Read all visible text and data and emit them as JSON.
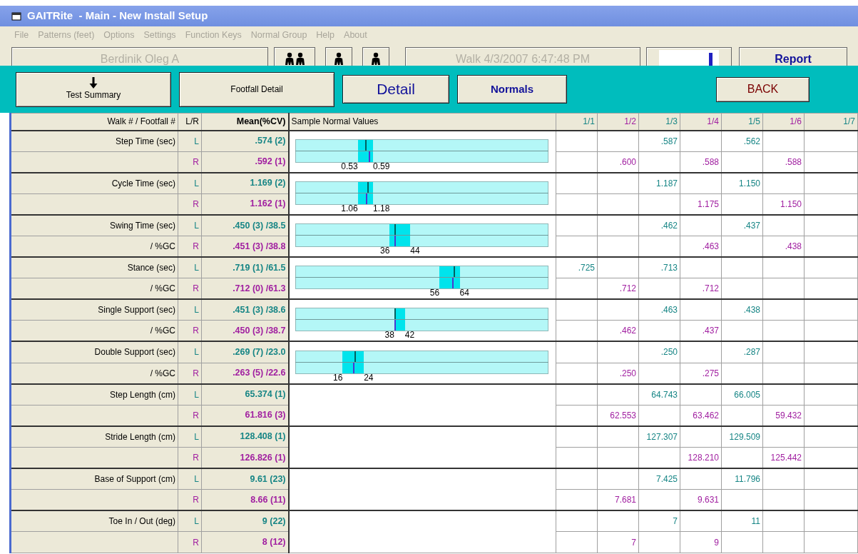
{
  "window": {
    "title": "GAITRite  - Main - New Install Setup"
  },
  "menu": [
    "File",
    "Patterns (feet)",
    "Options",
    "Settings",
    "Function Keys",
    "Normal Group",
    "Help",
    "About"
  ],
  "toolbar": {
    "patient": "Berdinik  Oleg A",
    "walk": "Walk  4/3/2007 6:47:48 PM",
    "report": "Report"
  },
  "nav_buttons": [
    {
      "label": "Test Summary",
      "kind": "arrow"
    },
    {
      "label": "Footfall Detail",
      "kind": "plain"
    },
    {
      "label": "Detail",
      "kind": "large"
    },
    {
      "label": "Normals",
      "kind": "bold"
    },
    {
      "label": "BACK",
      "kind": "back"
    }
  ],
  "table": {
    "columns": {
      "label": "Walk # / Footfall #",
      "side": "L/R",
      "mean": "Mean(%CV)",
      "normals": "Sample Normal Values"
    },
    "walk_columns": [
      {
        "label": "1/1",
        "color": "#168585"
      },
      {
        "label": "1/2",
        "color": "#a01ea0"
      },
      {
        "label": "1/3",
        "color": "#168585"
      },
      {
        "label": "1/4",
        "color": "#a01ea0"
      },
      {
        "label": "1/5",
        "color": "#168585"
      },
      {
        "label": "1/6",
        "color": "#a01ea0"
      },
      {
        "label": "1/7",
        "color": "#168585"
      }
    ],
    "groups": [
      {
        "rows": [
          {
            "label": "Step Time (sec)",
            "side": "L",
            "mean": ".574 (2)",
            "cells": [
              null,
              null,
              ".587",
              null,
              ".562",
              null,
              null
            ]
          },
          {
            "side": "R",
            "mean": ".592 (1)",
            "cells": [
              null,
              ".600",
              null,
              ".588",
              null,
              ".588",
              null
            ]
          }
        ],
        "gauge": {
          "low": {
            "label": "0.53",
            "level": 0.248
          },
          "high": {
            "label": "0.59",
            "level": 0.308
          },
          "markers": [
            {
              "kind": "upper",
              "level": 0.279
            },
            {
              "kind": "lower",
              "level": 0.295
            }
          ]
        }
      },
      {
        "rows": [
          {
            "label": "Cycle Time (sec)",
            "side": "L",
            "mean": "1.169 (2)",
            "cells": [
              null,
              null,
              "1.187",
              null,
              "1.150",
              null,
              null
            ]
          },
          {
            "side": "R",
            "mean": "1.162 (1)",
            "cells": [
              null,
              null,
              null,
              "1.175",
              null,
              "1.150",
              null
            ]
          }
        ],
        "gauge": {
          "low": {
            "label": "1.06",
            "level": 0.248
          },
          "high": {
            "label": "1.18",
            "level": 0.308
          },
          "markers": [
            {
              "kind": "upper",
              "level": 0.289
            },
            {
              "kind": "lower",
              "level": 0.284
            }
          ]
        }
      },
      {
        "rows": [
          {
            "label": "Swing Time (sec)",
            "side": "L",
            "mean": ".450 (3) /38.5",
            "cells": [
              null,
              null,
              ".462",
              null,
              ".437",
              null,
              null
            ]
          },
          {
            "label": "/ %GC",
            "side": "R",
            "mean": ".451 (3) /38.8",
            "cells": [
              null,
              null,
              null,
              ".463",
              null,
              ".438",
              null
            ]
          }
        ],
        "gauge": {
          "low": {
            "label": "36",
            "level": 0.374
          },
          "high": {
            "label": "44",
            "level": 0.455
          },
          "markers": [
            {
              "kind": "upper",
              "level": 0.394
            },
            {
              "kind": "lower",
              "level": 0.394
            }
          ]
        }
      },
      {
        "rows": [
          {
            "label": "Stance (sec)",
            "side": "L",
            "mean": ".719 (1) /61.5",
            "cells": [
              ".725",
              null,
              ".713",
              null,
              null,
              null,
              null
            ]
          },
          {
            "label": "/ %GC",
            "side": "R",
            "mean": ".712 (0) /61.3",
            "cells": [
              null,
              ".712",
              null,
              ".712",
              null,
              null,
              null
            ]
          }
        ],
        "gauge": {
          "low": {
            "label": "56",
            "level": 0.57
          },
          "high": {
            "label": "64",
            "level": 0.65
          },
          "markers": [
            {
              "kind": "upper",
              "level": 0.629
            },
            {
              "kind": "lower",
              "level": 0.623
            }
          ]
        }
      },
      {
        "rows": [
          {
            "label": "Single Support (sec)",
            "side": "L",
            "mean": ".451 (3) /38.6",
            "cells": [
              null,
              null,
              ".463",
              null,
              ".438",
              null,
              null
            ]
          },
          {
            "label": "/ %GC",
            "side": "R",
            "mean": ".450 (3) /38.7",
            "cells": [
              null,
              ".462",
              null,
              ".437",
              null,
              null,
              null
            ]
          }
        ],
        "gauge": {
          "low": {
            "label": "38",
            "level": 0.392
          },
          "high": {
            "label": "42",
            "level": 0.434
          },
          "markers": [
            {
              "kind": "upper",
              "level": 0.394
            },
            {
              "kind": "lower",
              "level": 0.394
            }
          ]
        }
      },
      {
        "rows": [
          {
            "label": "Double Support (sec)",
            "side": "L",
            "mean": ".269 (7) /23.0",
            "cells": [
              null,
              null,
              ".250",
              null,
              ".287",
              null,
              null
            ]
          },
          {
            "label": "/ %GC",
            "side": "R",
            "mean": ".263 (5) /22.6",
            "cells": [
              null,
              ".250",
              null,
              ".275",
              null,
              null,
              null
            ]
          }
        ],
        "gauge": {
          "low": {
            "label": "16",
            "level": 0.188
          },
          "high": {
            "label": "24",
            "level": 0.272
          },
          "markers": [
            {
              "kind": "upper",
              "level": 0.238
            },
            {
              "kind": "lower",
              "level": 0.232
            }
          ]
        }
      },
      {
        "rows": [
          {
            "label": "Step Length (cm)",
            "side": "L",
            "mean": "65.374 (1)",
            "cells": [
              null,
              null,
              "64.743",
              null,
              "66.005",
              null,
              null
            ]
          },
          {
            "side": "R",
            "mean": "61.816 (3)",
            "cells": [
              null,
              "62.553",
              null,
              "63.462",
              null,
              "59.432",
              null
            ]
          }
        ]
      },
      {
        "rows": [
          {
            "label": "Stride Length (cm)",
            "side": "L",
            "mean": "128.408 (1)",
            "cells": [
              null,
              null,
              "127.307",
              null,
              "129.509",
              null,
              null
            ]
          },
          {
            "side": "R",
            "mean": "126.826 (1)",
            "cells": [
              null,
              null,
              null,
              "128.210",
              null,
              "125.442",
              null
            ]
          }
        ]
      },
      {
        "rows": [
          {
            "label": "Base of Support (cm)",
            "side": "L",
            "mean": "9.61 (23)",
            "cells": [
              null,
              null,
              "7.425",
              null,
              "11.796",
              null,
              null
            ]
          },
          {
            "side": "R",
            "mean": "8.66 (11)",
            "cells": [
              null,
              "7.681",
              null,
              "9.631",
              null,
              null,
              null
            ]
          }
        ]
      },
      {
        "rows": [
          {
            "label": "Toe In / Out (deg)",
            "side": "L",
            "mean": "9 (22)",
            "cells": [
              null,
              null,
              "7",
              null,
              "11",
              null,
              null
            ]
          },
          {
            "side": "R",
            "mean": "8 (12)",
            "cells": [
              null,
              "7",
              null,
              "9",
              null,
              null,
              null
            ]
          }
        ]
      }
    ]
  }
}
